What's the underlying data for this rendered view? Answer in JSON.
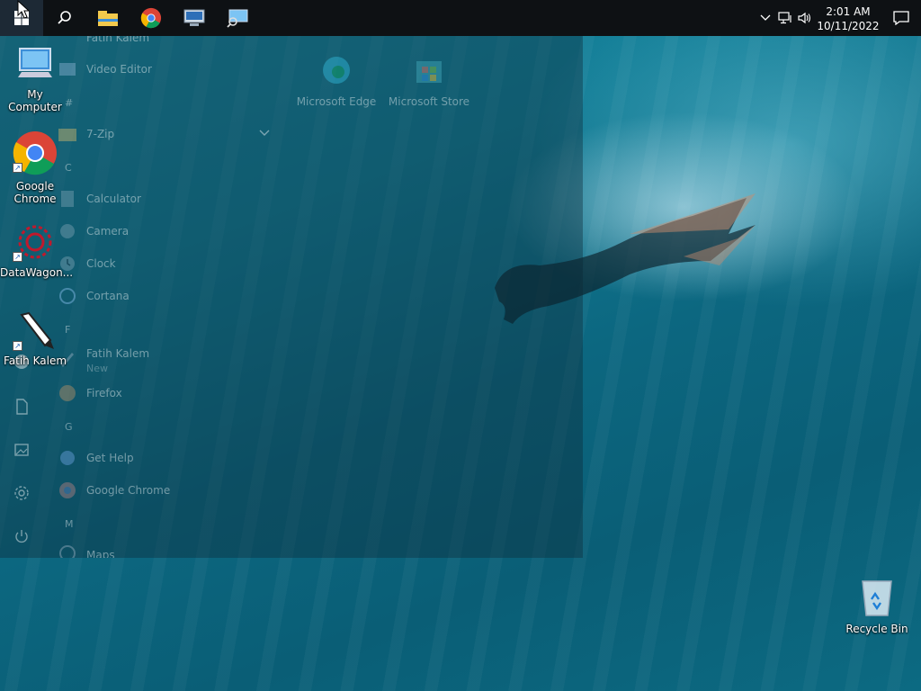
{
  "taskbar": {
    "start_icon": "windows-logo-icon",
    "pinned": [
      {
        "name": "search-icon"
      },
      {
        "name": "file-explorer-icon"
      },
      {
        "name": "google-chrome-icon"
      },
      {
        "name": "remote-desktop-icon"
      },
      {
        "name": "network-monitor-icon"
      }
    ],
    "tray": {
      "time": "2:01 AM",
      "date": "10/11/2022",
      "icons": [
        "chevron-up-icon",
        "network-icon",
        "volume-icon"
      ],
      "notification_icon": "action-center-icon"
    }
  },
  "start_menu": {
    "items": [
      {
        "label": "Fatih Kalem"
      },
      {
        "label": "Video Editor"
      },
      {
        "label": "7-Zip"
      },
      {
        "label": "Calculator"
      },
      {
        "label": "Camera"
      },
      {
        "label": "Clock"
      },
      {
        "label": "Cortana"
      },
      {
        "label": "Fatih Kalem"
      },
      {
        "label": "Firefox"
      },
      {
        "label": "Get Help"
      },
      {
        "label": "Google Chrome"
      },
      {
        "label": "Maps"
      }
    ],
    "letters": [
      "#",
      "C",
      "F",
      "G",
      "M"
    ],
    "new_badge": "New",
    "tiles": [
      {
        "label": "Microsoft Edge"
      },
      {
        "label": "Microsoft Store"
      }
    ]
  },
  "desktop": {
    "icons": [
      {
        "label": "My Computer"
      },
      {
        "label": "Google Chrome"
      },
      {
        "label": "DataWagon..."
      },
      {
        "label": "Fatih Kalem"
      },
      {
        "label": "Recycle Bin"
      }
    ]
  },
  "colors": {
    "taskbar": "#0e1114",
    "start_active": "#1d2935",
    "water": "#0c6780"
  }
}
